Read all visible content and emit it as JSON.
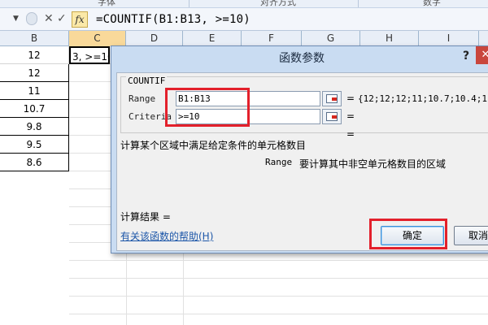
{
  "ribbon": {
    "groups": [
      "字体",
      "对齐方式",
      "数字"
    ]
  },
  "formula_bar": {
    "formula": "=COUNTIF(B1:B13, >=10)",
    "fx_label": "fx"
  },
  "columns": [
    "B",
    "C",
    "D",
    "E",
    "F",
    "G",
    "H",
    "I"
  ],
  "cells_b": [
    "12",
    "12",
    "11",
    "10.7",
    "9.8",
    "9.5",
    "8.6"
  ],
  "cell_c1": "3, >=10)",
  "dialog": {
    "title": "函数参数",
    "help_glyph": "?",
    "close_glyph": "✕",
    "function_name": "COUNTIF",
    "args": [
      {
        "label": "Range",
        "value": "B1:B13",
        "result": "{12;12;12;11;10.7;10.4;1."
      },
      {
        "label": "Criteria",
        "value": ">=10",
        "result": ""
      }
    ],
    "eq": "=",
    "description": "计算某个区域中满足给定条件的单元格数目",
    "param_name": "Range",
    "param_description": "要计算其中非空单元格数目的区域",
    "result_label": "计算结果 =",
    "help_link": "有关该函数的帮助(H)",
    "ok_label": "确定",
    "cancel_label": "取消"
  }
}
